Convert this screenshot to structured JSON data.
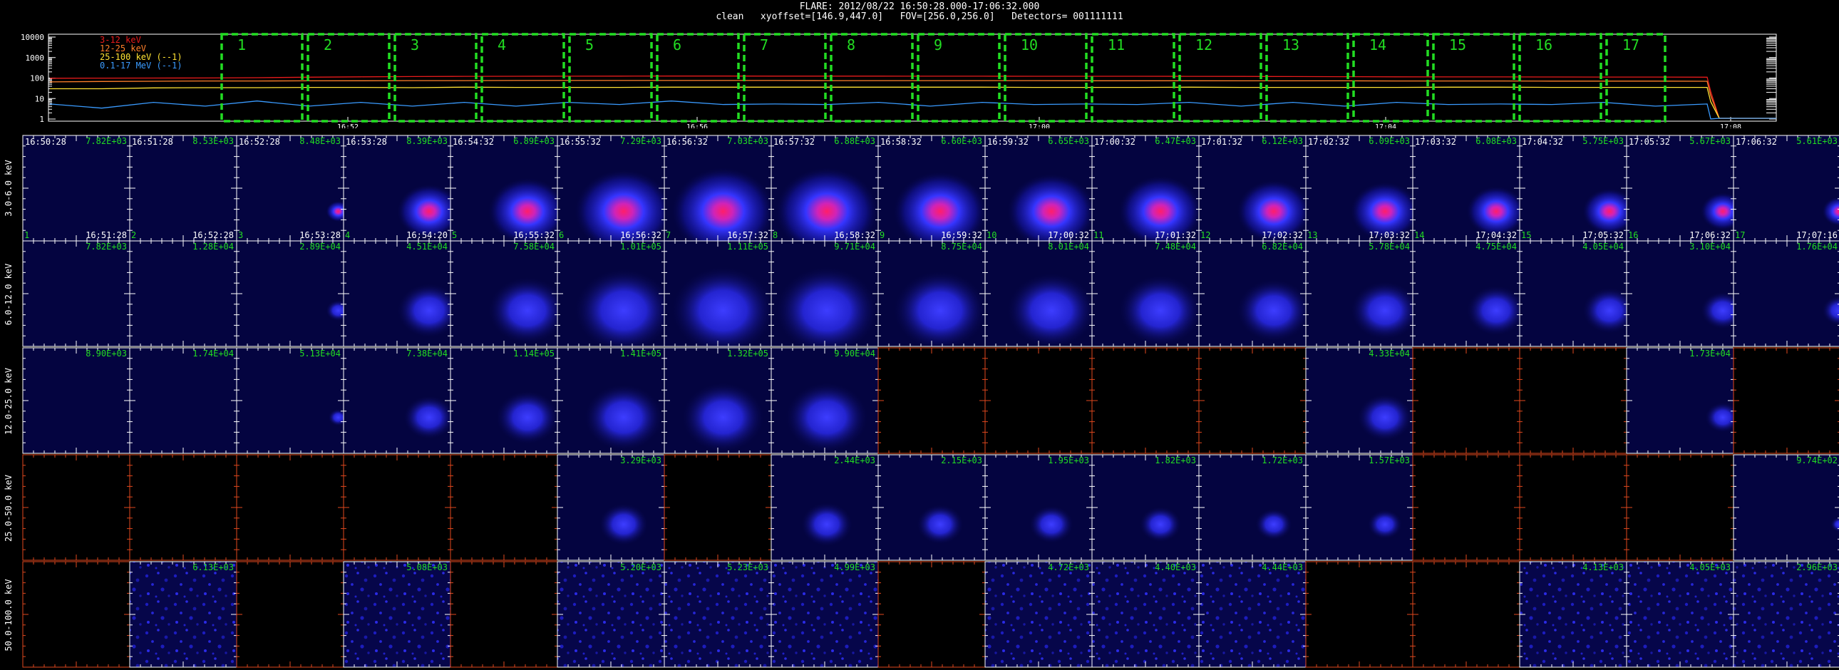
{
  "header": {
    "line1": "FLARE: 2012/08/22 16:50:28.000-17:06:32.000",
    "line2": "clean   xyoffset=[146.9,447.0]   FOV=[256.0,256.0]   Detectors= 001111111"
  },
  "lightcurve": {
    "y_ticks": [
      "10000",
      "1000",
      "100",
      "10",
      "1"
    ],
    "x_ticks": [
      "16:52",
      "16:56",
      "17:00",
      "17:04",
      "17:08"
    ],
    "legend": [
      {
        "label": "3-12 keV",
        "color": "#e81b1b"
      },
      {
        "label": "12-25 keV",
        "color": "#ff7f2a"
      },
      {
        "label": "25-100 keV (--1)",
        "color": "#ffe333"
      },
      {
        "label": "0.1-17 MeV (--1)",
        "color": "#3a9bff"
      }
    ],
    "interval_numbers": [
      "1",
      "2",
      "3",
      "4",
      "5",
      "6",
      "7",
      "8",
      "9",
      "10",
      "11",
      "12",
      "13",
      "14",
      "15",
      "16",
      "17"
    ],
    "curves": {
      "3-12 keV": [
        98,
        99,
        100,
        101,
        104,
        110,
        115,
        118,
        121,
        122,
        123,
        124,
        125,
        125,
        124,
        124,
        124,
        123,
        123,
        122,
        122,
        122,
        121,
        120,
        118,
        116,
        115,
        114,
        114,
        113,
        112,
        112,
        110
      ],
      "12-25 keV": [
        65,
        68,
        70,
        72,
        72,
        73,
        74,
        75,
        75,
        76,
        76,
        76,
        76,
        76,
        76,
        75,
        75,
        75,
        75,
        75,
        74,
        74,
        74,
        73,
        73,
        73,
        72,
        72,
        72,
        71,
        71,
        71,
        70
      ],
      "25-100 keV": [
        30,
        30,
        33,
        34,
        34,
        35,
        35,
        34,
        36,
        35,
        35,
        35,
        36,
        36,
        36,
        36,
        36,
        36,
        36,
        35,
        35,
        35,
        36,
        35,
        35,
        35,
        35,
        36,
        36,
        35,
        35,
        35,
        35
      ],
      "0.1-17 MeV": [
        5,
        4,
        6,
        5,
        7,
        5,
        6,
        5,
        6,
        5,
        6,
        6,
        7,
        6,
        5,
        6,
        6,
        5,
        6,
        6,
        5,
        6,
        6,
        5,
        6,
        5,
        6,
        6,
        5,
        6,
        6,
        5,
        5
      ]
    }
  },
  "row_labels": [
    "3.0-6.0 keV",
    "6.0-12.0 keV",
    "12.0-25.0 keV",
    "25.0-50.0 keV",
    "50.0-100.0 keV"
  ],
  "start_times": [
    "16:50:28",
    "16:51:28",
    "16:52:28",
    "16:53:28",
    "16:54:32",
    "16:55:32",
    "16:56:32",
    "16:57:32",
    "16:58:32",
    "16:59:32",
    "17:00:32",
    "17:01:32",
    "17:02:32",
    "17:03:32",
    "17:04:32",
    "17:05:32",
    "17:06:32"
  ],
  "end_times": [
    "16:51:28",
    "16:52:28",
    "16:53:28",
    "16:54:20",
    "16:55:32",
    "16:56:32",
    "16:57:32",
    "16:58:32",
    "16:59:32",
    "17:00:32",
    "17:01:32",
    "17:02:32",
    "17:03:32",
    "17:04:32",
    "17:05:32",
    "17:06:32",
    "17:07:16"
  ],
  "peaks": [
    [
      "7.82E+03",
      "8.53E+03",
      "8.48E+03",
      "8.39E+03",
      "6.89E+03",
      "7.29E+03",
      "7.03E+03",
      "6.88E+03",
      "6.60E+03",
      "6.65E+03",
      "6.47E+03",
      "6.12E+03",
      "6.09E+03",
      "6.08E+03",
      "5.75E+03",
      "5.67E+03",
      "5.61E+03"
    ],
    [
      "7.82E+03",
      "1.28E+04",
      "2.89E+04",
      "4.51E+04",
      "7.58E+04",
      "1.01E+05",
      "1.11E+05",
      "9.71E+04",
      "8.75E+04",
      "8.01E+04",
      "7.48E+04",
      "6.82E+04",
      "5.78E+04",
      "4.75E+04",
      "4.05E+04",
      "3.10E+04",
      "1.76E+04"
    ],
    [
      "8.90E+03",
      "1.74E+04",
      "5.13E+04",
      "7.38E+04",
      "1.14E+05",
      "1.41E+05",
      "1.32E+05",
      "9.90E+04",
      "",
      "",
      "",
      "",
      "4.33E+04",
      "",
      "",
      "1.73E+04",
      ""
    ],
    [
      "",
      "",
      "",
      "",
      "",
      "3.29E+03",
      "",
      "2.44E+03",
      "2.15E+03",
      "1.95E+03",
      "1.82E+03",
      "1.72E+03",
      "1.57E+03",
      "",
      "",
      "",
      "9.74E+02"
    ],
    [
      "",
      "6.13E+03",
      "",
      "5.08E+03",
      "",
      "5.20E+03",
      "5.23E+03",
      "4.99E+03",
      "",
      "4.72E+03",
      "4.40E+03",
      "4.44E+03",
      "",
      "",
      "4.13E+03",
      "4.05E+03",
      "2.96E+03"
    ]
  ],
  "image_grid": [
    [
      1,
      1,
      1,
      1,
      1,
      1,
      1,
      1,
      1,
      1,
      1,
      1,
      1,
      1,
      1,
      1,
      1
    ],
    [
      1,
      1,
      1,
      1,
      1,
      1,
      1,
      1,
      1,
      1,
      1,
      1,
      1,
      1,
      1,
      1,
      1
    ],
    [
      1,
      1,
      1,
      1,
      1,
      1,
      1,
      1,
      0,
      0,
      0,
      0,
      1,
      0,
      0,
      1,
      0
    ],
    [
      0,
      0,
      0,
      0,
      0,
      1,
      0,
      1,
      1,
      1,
      1,
      1,
      1,
      0,
      0,
      0,
      1
    ],
    [
      0,
      1,
      0,
      1,
      0,
      1,
      1,
      1,
      0,
      1,
      1,
      1,
      0,
      0,
      1,
      1,
      1
    ]
  ],
  "colors": {
    "frame": "#ffffff",
    "empty_frame": "#e0481e",
    "interval_box": "#22dd22",
    "peak_text": "#22dd22",
    "index_text": "#22dd22",
    "panel_bg": "#040440",
    "source": "#3535ff",
    "core": "#ff1e6a"
  }
}
